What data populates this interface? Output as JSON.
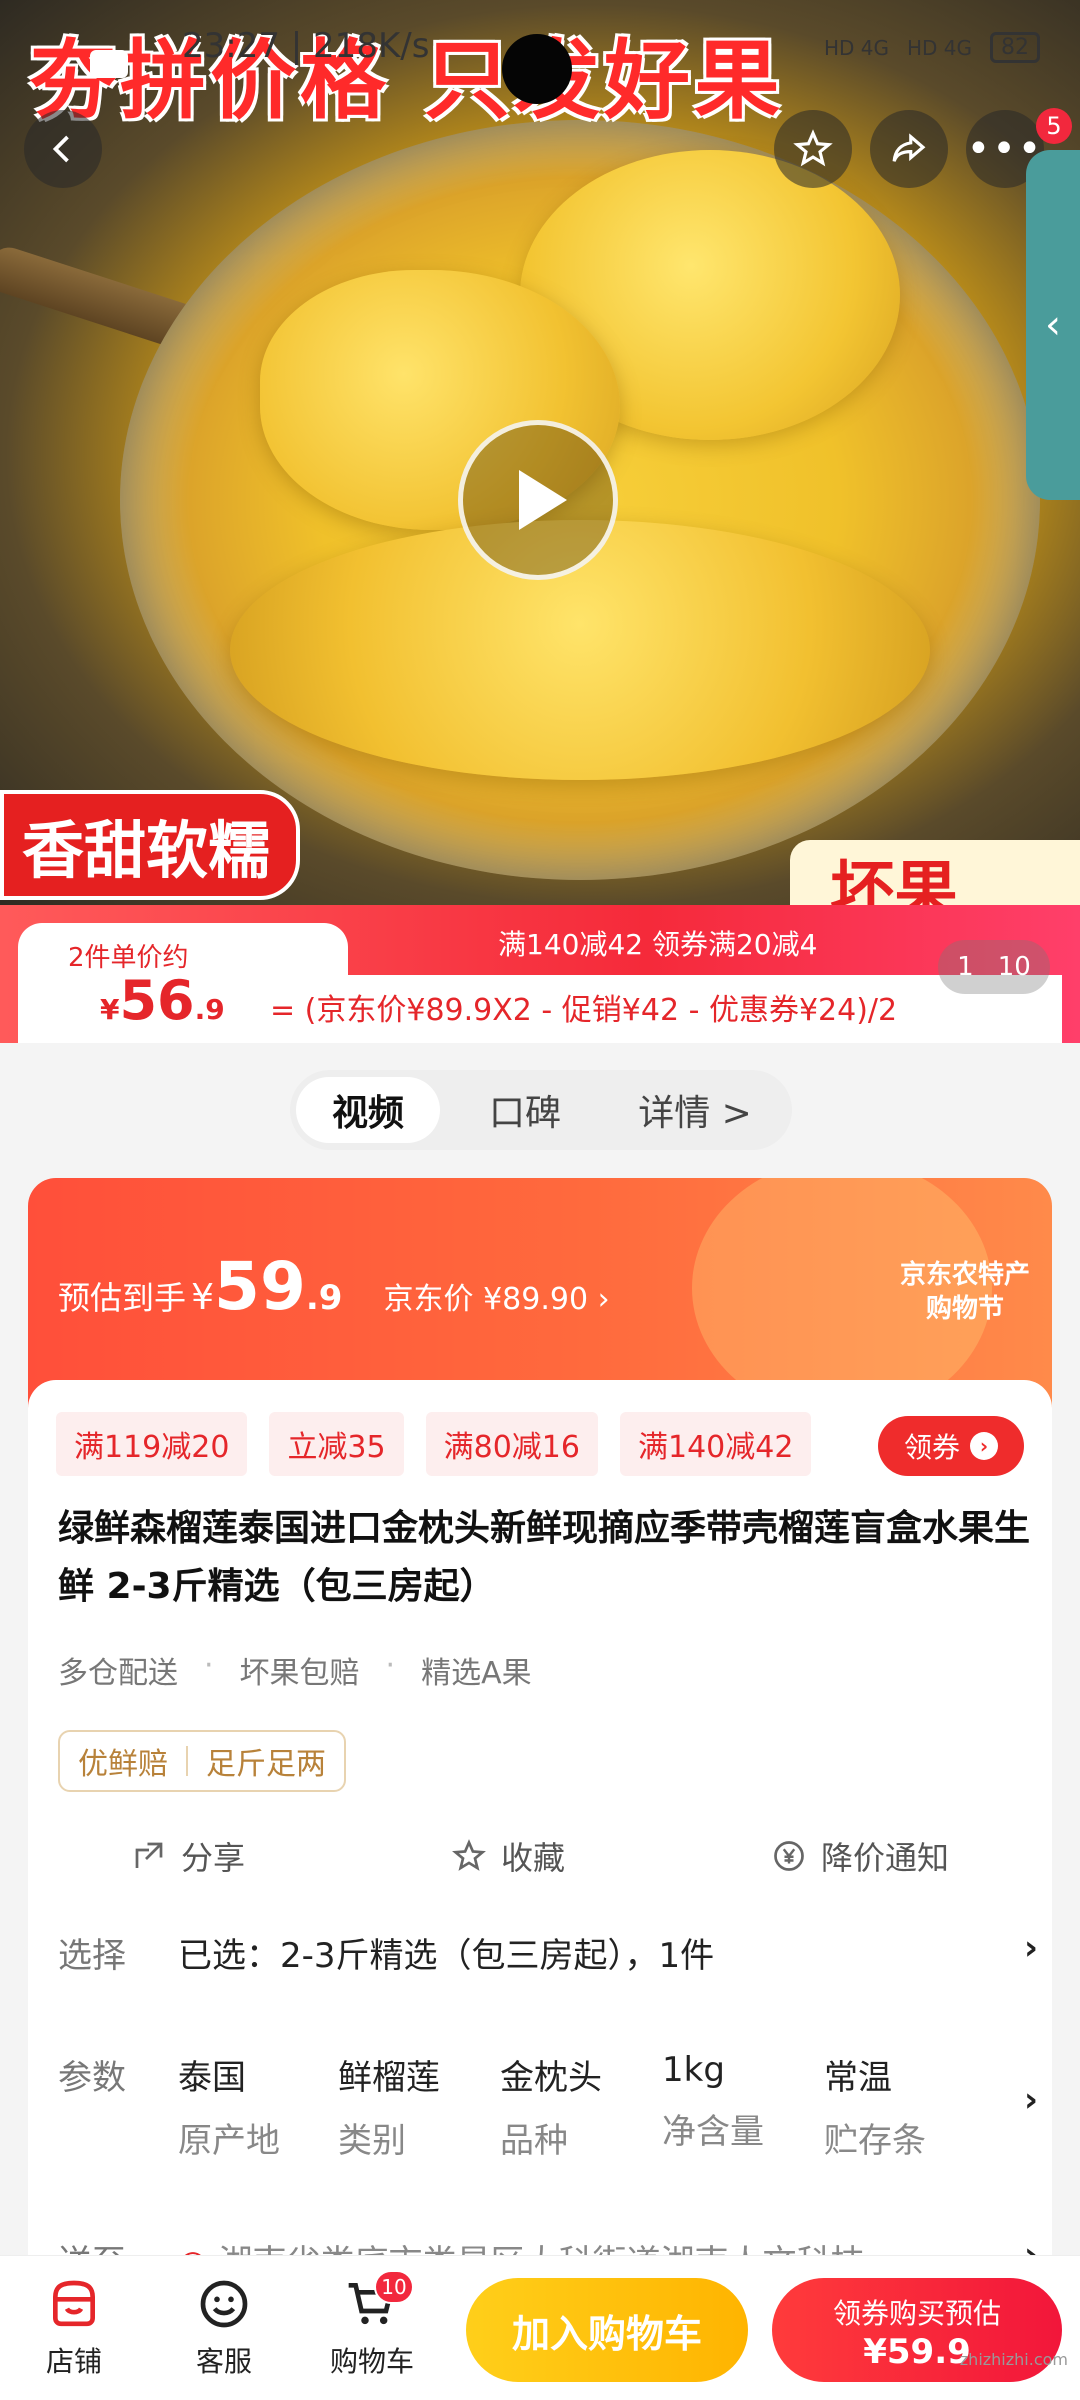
{
  "status_bar": {
    "time": "23:27 | 218K/s",
    "network1": "HD 4G",
    "network2": "HD 4G",
    "battery": "82"
  },
  "hero": {
    "headline": "夯拼价格 只发好果",
    "tag_left": "香甜软糯",
    "tag_right": "坏果",
    "cart_count_badge": "5",
    "page_current": "1",
    "page_total": "10"
  },
  "price_banner": {
    "label": "2件单价约",
    "currency": "¥",
    "price_int": "56",
    "price_dec": ".9",
    "promo_line": "满140减42  领券满20减4",
    "formula": "= (京东价¥89.9X2 - 促销¥42 - 优惠券¥24)/2"
  },
  "tabs": [
    {
      "label": "视频",
      "active": true
    },
    {
      "label": "口碑",
      "active": false
    },
    {
      "label": "详情 >",
      "active": false
    }
  ],
  "promo": {
    "label": "预估到手",
    "currency": "¥",
    "price_int": "59",
    "price_dec": ".9",
    "jd_price": "京东价 ¥89.90 ›",
    "festival_line1": "京东农特产",
    "festival_line2": "购物节"
  },
  "coupons": [
    "满119减20",
    "立减35",
    "满80减16",
    "满140减42"
  ],
  "claim_button": "领券",
  "product_title": "绿鲜森榴莲泰国进口金枕头新鲜现摘应季带壳榴莲盲盒水果生鲜 2-3斤精选（包三房起）",
  "features": [
    "多仓配送",
    "坏果包赔",
    "精选A果"
  ],
  "guarantee": [
    "优鲜赔",
    "足斤足两"
  ],
  "actions": {
    "share": "分享",
    "favorite": "收藏",
    "price_alert": "降价通知"
  },
  "selection": {
    "key": "选择",
    "value": "已选：2-3斤精选（包三房起），1件"
  },
  "params": {
    "key": "参数",
    "items": [
      {
        "value": "泰国",
        "label": "原产地"
      },
      {
        "value": "鲜榴莲",
        "label": "类别"
      },
      {
        "value": "金枕头",
        "label": "品种"
      },
      {
        "value": "1kg",
        "label": "净含量"
      },
      {
        "value": "常温",
        "label": "贮存条"
      }
    ]
  },
  "shipping": {
    "key": "送至",
    "value": "湖南省娄底市娄星区大科街道湖南人文科技"
  },
  "bottom_bar": {
    "store": "店铺",
    "service": "客服",
    "cart": "购物车",
    "cart_count": "10",
    "add_to_cart": "加入购物车",
    "buy_line1": "领券购买预估",
    "buy_line2": "¥59.9"
  },
  "watermark": "zhizhizhi.com"
}
